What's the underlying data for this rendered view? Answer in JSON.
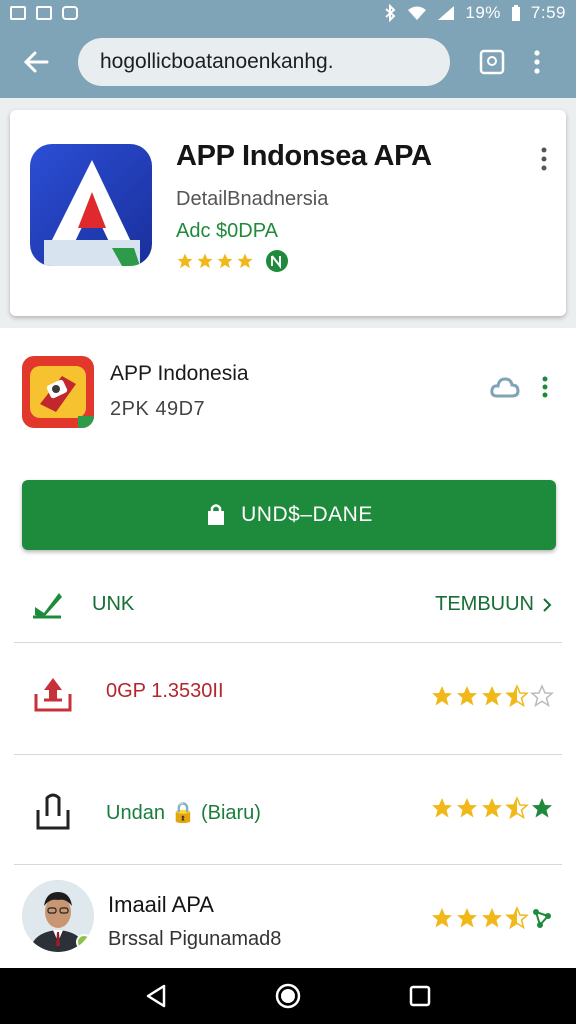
{
  "status_bar": {
    "battery": "19%",
    "time": "7:59",
    "icons": [
      "photo-icon",
      "image-icon",
      "message-icon",
      "bluetooth-icon",
      "wifi-icon",
      "signal-icon",
      "battery-icon"
    ]
  },
  "browser": {
    "url": "hogollicboatanoenkanhg.",
    "back_icon": "arrow-left-icon",
    "tab_icon": "tab-switch-icon",
    "menu_icon": "more-vert-icon"
  },
  "featured": {
    "title": "APP Indonsea APA",
    "subtitle": "DetailBnadnersia",
    "price": "Adc $0DPA",
    "rating_stars": 4,
    "badge_icon": "verified-badge-icon"
  },
  "app": {
    "name": "APP Indonesia",
    "meta": "2PK  49D7",
    "install_label": "UND$–DANE"
  },
  "link_row": {
    "label": "UNK",
    "action": "TEMBUUN",
    "action_icon": "chevron-right-icon"
  },
  "info_rows": [
    {
      "text": "0GP 1.3530II",
      "color": "#b3262b",
      "icon": "download-tray-icon",
      "rating": 3.5
    },
    {
      "text": "Undan 🔒 (Biaru)",
      "color": "#1b7d3b",
      "icon": "share-icon",
      "rating": 3.5
    }
  ],
  "person": {
    "name": "Imaail APA",
    "subtitle": "Brssal Pigunamad8",
    "rating": 3.5
  },
  "colors": {
    "toolbar": "#7fa3b7",
    "green": "#1e8a3c",
    "star": "#f1b81a",
    "red": "#b3262b"
  }
}
